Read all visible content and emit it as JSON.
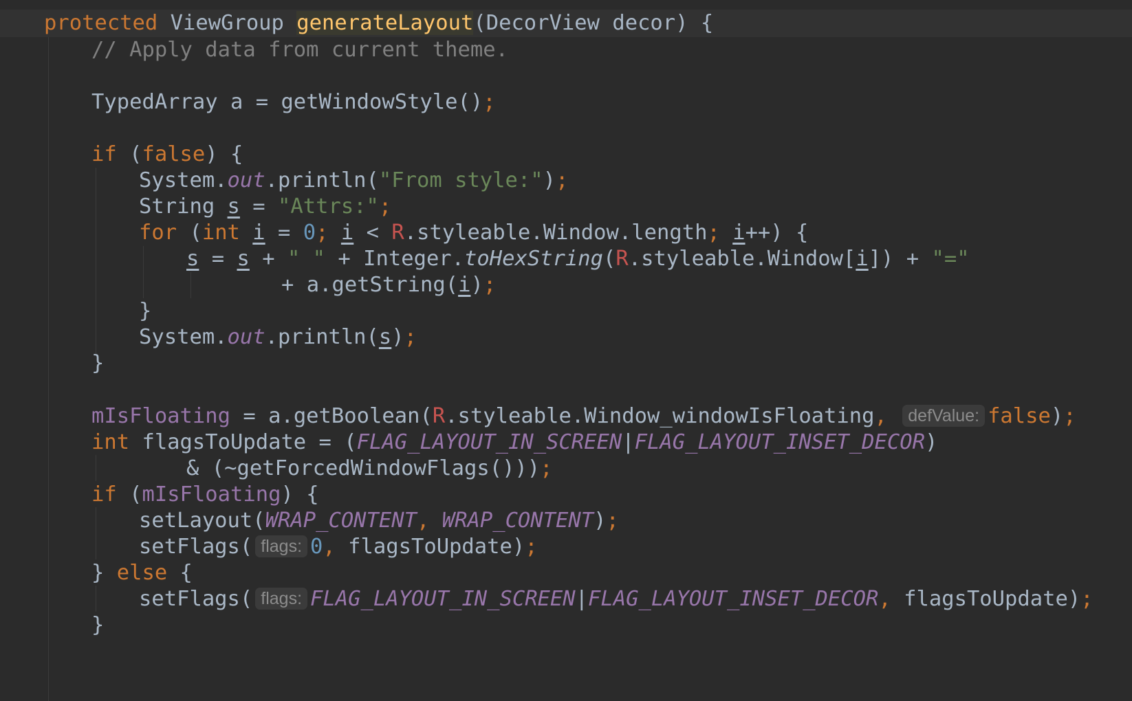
{
  "editor": {
    "colors": {
      "background": "#2b2b2b",
      "keyword": "#cc7832",
      "method_declaration": "#ffc66d",
      "comment": "#808080",
      "string": "#6a8759",
      "number": "#6897bb",
      "field": "#9876aa",
      "plain": "#a9b7c6",
      "error_R": "#c75450"
    },
    "tokens": {
      "protected": "protected ",
      "viewgroup": "ViewGroup ",
      "generate_layout": "generateLayout",
      "decor_param": "(DecorView decor) {",
      "comment": "// Apply data from current theme.",
      "typed_array": "TypedArray a = getWindowStyle()",
      "semi": ";",
      "if_kw": "if",
      "false_kw": "false",
      "open_paren": " (",
      "close_brace_open": ") {",
      "system": "System.",
      "out": "out",
      "println_open": ".println(",
      "from_style": "\"From style:\"",
      "close_paren": ")",
      "string_s": "String ",
      "s": "s",
      "equals": " = ",
      "attrs": "\"Attrs:\"",
      "for_kw": "for",
      "int_kw": "int",
      "i": "i",
      "zero": "0",
      "lt": " < ",
      "r": "R",
      "window_length": ".styleable.Window.length",
      "plus_plus": "++) {",
      "plus": " + ",
      "space_str": "\" \"",
      "integer": "Integer.",
      "to_hex_string": "toHexString",
      "open": "(",
      "window_index": ".styleable.Window[",
      "index_close": "])",
      "eq_str": "\"=\"",
      "get_string": "+ a.getString(",
      "close_brace": "}",
      "is_floating": "mIsFloating",
      "get_boolean": " = a.getBoolean(",
      "window_is_floating": ".styleable.Window_windowIsFloating",
      "comma": ",",
      "def_value_hint": "defValue:",
      "flags_to_update_decl": " flagsToUpdate = (",
      "flag_in_screen": "FLAG_LAYOUT_IN_SCREEN",
      "bar": "|",
      "flag_inset_decor": "FLAG_LAYOUT_INSET_DECOR",
      "forced_flags": "& (~getForcedWindowFlags()))",
      "open_brace_close": ") {",
      "set_layout": "setLayout(",
      "wrap_content": "WRAP_CONTENT",
      "comma_space": ", ",
      "set_flags": "setFlags(",
      "flags_hint": "flags:",
      "flags_to_update": "flagsToUpdate)",
      "else_open": "} ",
      "else_kw": "else",
      "brace_open": " {"
    }
  }
}
